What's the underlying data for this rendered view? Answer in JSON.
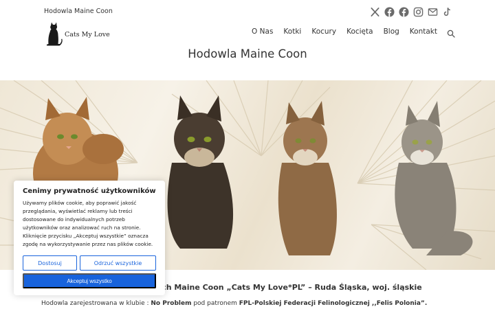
{
  "topbar": {
    "tagline": "Hodowla Maine Coon",
    "social": [
      "x-icon",
      "facebook-icon",
      "facebook-icon",
      "instagram-icon",
      "email-icon",
      "tiktok-icon"
    ]
  },
  "header": {
    "brand": "Cats My Love",
    "nav": [
      "O Nas",
      "Kotki",
      "Kocury",
      "Kocięta",
      "Blog",
      "Kontakt"
    ]
  },
  "page": {
    "title": "Hodowla Maine Coon",
    "subheading_visible": "ych Maine Coon „Cats My Love*PL” – Ruda Śląska, woj. śląskie",
    "info": {
      "prefix": "Hodowla zarejestrowana w klubie : ",
      "club": "No Problem",
      "middle": " pod patronem ",
      "federation": "FPL-Polskiej Federacji Felinologicznej ,,Felis Polonia”."
    }
  },
  "consent": {
    "title": "Cenimy prywatność użytkowników",
    "body": "Używamy plików cookie, aby poprawić jakość przeglądania, wyświetlać reklamy lub treści dostosowane do indywidualnych potrzeb użytkowników oraz analizować ruch na stronie. Kliknięcie przycisku „Akceptuj wszystkie” oznacza zgodę na wykorzystywanie przez nas plików cookie.",
    "customize": "Dostosuj",
    "reject": "Odrzuć wszystkie",
    "accept": "Akceptuj wszystko"
  },
  "colors": {
    "accent": "#1863dc",
    "icons": "#6b6b6b"
  }
}
